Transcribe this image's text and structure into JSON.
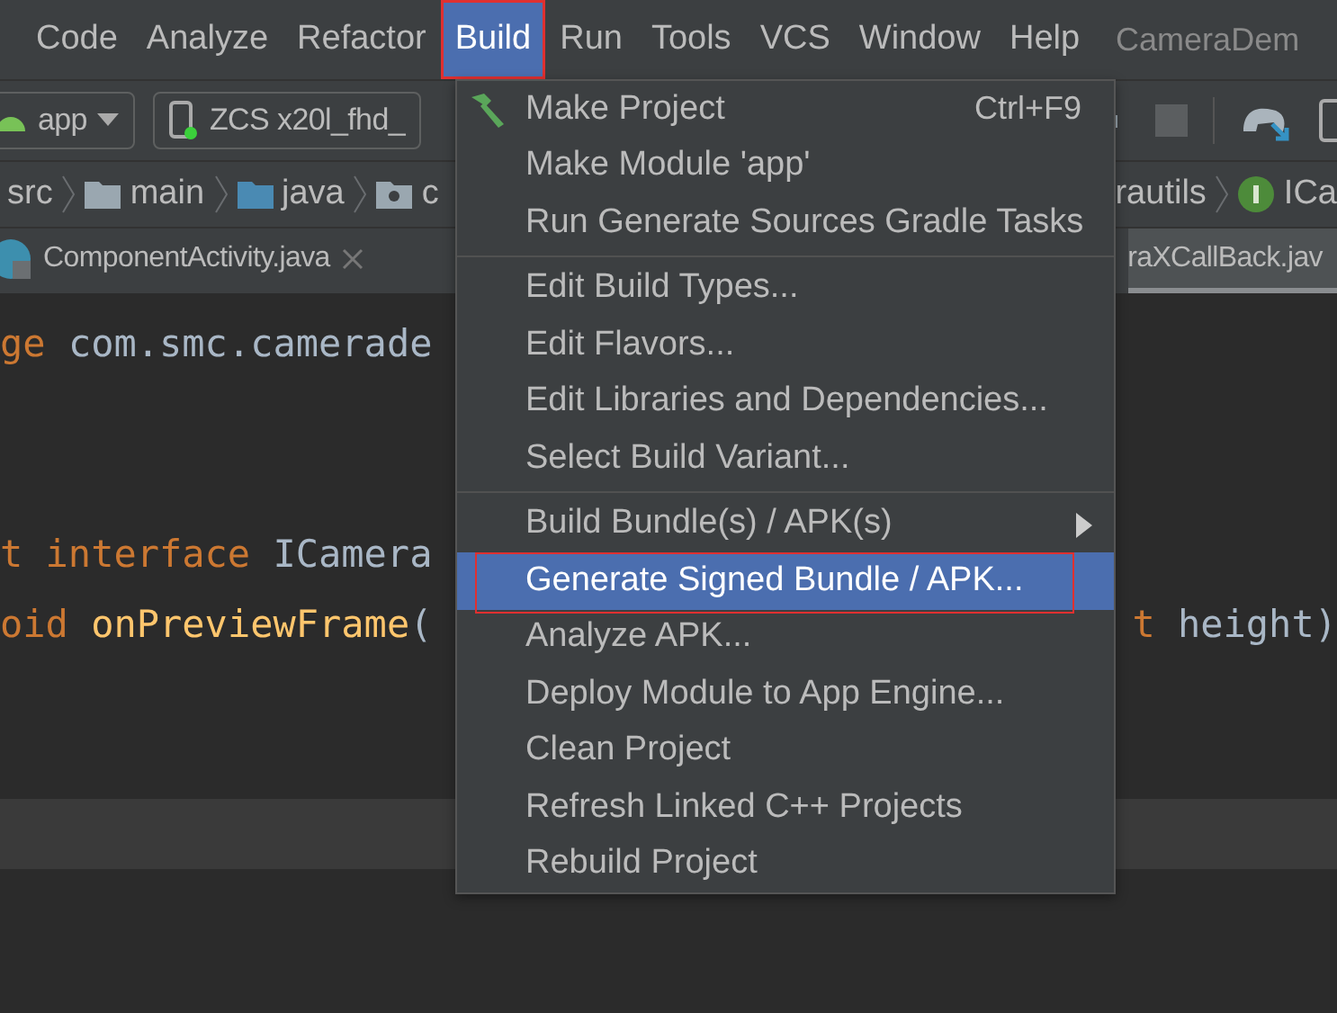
{
  "menu_bar": {
    "items": [
      {
        "label": "Code",
        "selected": false,
        "annotated": false
      },
      {
        "label": "Analyze",
        "selected": false,
        "annotated": false
      },
      {
        "label": "Refactor",
        "selected": false,
        "annotated": false
      },
      {
        "label": "Build",
        "selected": true,
        "annotated": true
      },
      {
        "label": "Run",
        "selected": false,
        "annotated": false
      },
      {
        "label": "Tools",
        "selected": false,
        "annotated": false
      },
      {
        "label": "VCS",
        "selected": false,
        "annotated": false
      },
      {
        "label": "Window",
        "selected": false,
        "annotated": false
      },
      {
        "label": "Help",
        "selected": false,
        "annotated": false
      }
    ],
    "project_title": "CameraDem"
  },
  "toolbar": {
    "run_config": "app",
    "device": "ZCS x20l_fhd_"
  },
  "breadcrumbs": {
    "left": [
      {
        "label": "src",
        "kind": "plain"
      },
      {
        "label": "main",
        "kind": "folder"
      },
      {
        "label": "java",
        "kind": "source-folder"
      },
      {
        "label": "c",
        "kind": "package"
      }
    ],
    "right": [
      {
        "label": "rautils",
        "kind": "plain"
      },
      {
        "label": "ICa",
        "kind": "interface"
      }
    ]
  },
  "tabs": [
    {
      "label": "ComponentActivity.java",
      "selected": false,
      "close_icon": true
    },
    {
      "label": "raXCallBack.jav",
      "selected": true,
      "close_icon": false
    }
  ],
  "editor": {
    "lines": [
      {
        "current": false,
        "left": [
          {
            "text": "ge",
            "kind": "keyword"
          },
          {
            "text": " com.smc.camerade",
            "kind": "plain"
          }
        ]
      },
      {
        "current": false
      },
      {
        "current": false
      },
      {
        "current": false,
        "left": [
          {
            "text": "t interface",
            "kind": "keyword"
          },
          {
            "text": " ICamera",
            "kind": "plain"
          }
        ]
      },
      {
        "current": false,
        "left": [
          {
            "text": "oid",
            "kind": "keyword"
          },
          {
            "text": " onPreviewFrame",
            "kind": "method"
          },
          {
            "text": "(",
            "kind": "plain"
          }
        ],
        "right": [
          {
            "text": "t",
            "kind": "keyword"
          },
          {
            "text": " height)",
            "kind": "plain"
          }
        ]
      },
      {
        "current": false
      },
      {
        "current": false
      },
      {
        "current": true
      }
    ]
  },
  "build_menu": {
    "groups": [
      [
        {
          "label": "Make Project",
          "shortcut": "Ctrl+F9",
          "submenu": false,
          "selected": false,
          "annotated": false
        },
        {
          "label": "Make Module 'app'",
          "submenu": false,
          "selected": false,
          "annotated": false
        },
        {
          "label": "Run Generate Sources Gradle Tasks",
          "submenu": false,
          "selected": false,
          "annotated": false
        }
      ],
      [
        {
          "label": "Edit Build Types...",
          "submenu": false,
          "selected": false,
          "annotated": false
        },
        {
          "label": "Edit Flavors...",
          "submenu": false,
          "selected": false,
          "annotated": false
        },
        {
          "label": "Edit Libraries and Dependencies...",
          "submenu": false,
          "selected": false,
          "annotated": false
        },
        {
          "label": "Select Build Variant...",
          "submenu": false,
          "selected": false,
          "annotated": false
        }
      ],
      [
        {
          "label": "Build Bundle(s) / APK(s)",
          "submenu": true,
          "selected": false,
          "annotated": false
        },
        {
          "label": "Generate Signed Bundle / APK...",
          "submenu": false,
          "selected": true,
          "annotated": true
        },
        {
          "label": "Analyze APK...",
          "submenu": false,
          "selected": false,
          "annotated": false
        },
        {
          "label": "Deploy Module to App Engine...",
          "submenu": false,
          "selected": false,
          "annotated": false
        },
        {
          "label": "Clean Project",
          "submenu": false,
          "selected": false,
          "annotated": false
        },
        {
          "label": "Refresh Linked C++ Projects",
          "submenu": false,
          "selected": false,
          "annotated": false
        },
        {
          "label": "Rebuild Project",
          "submenu": false,
          "selected": false,
          "annotated": false
        }
      ]
    ]
  }
}
